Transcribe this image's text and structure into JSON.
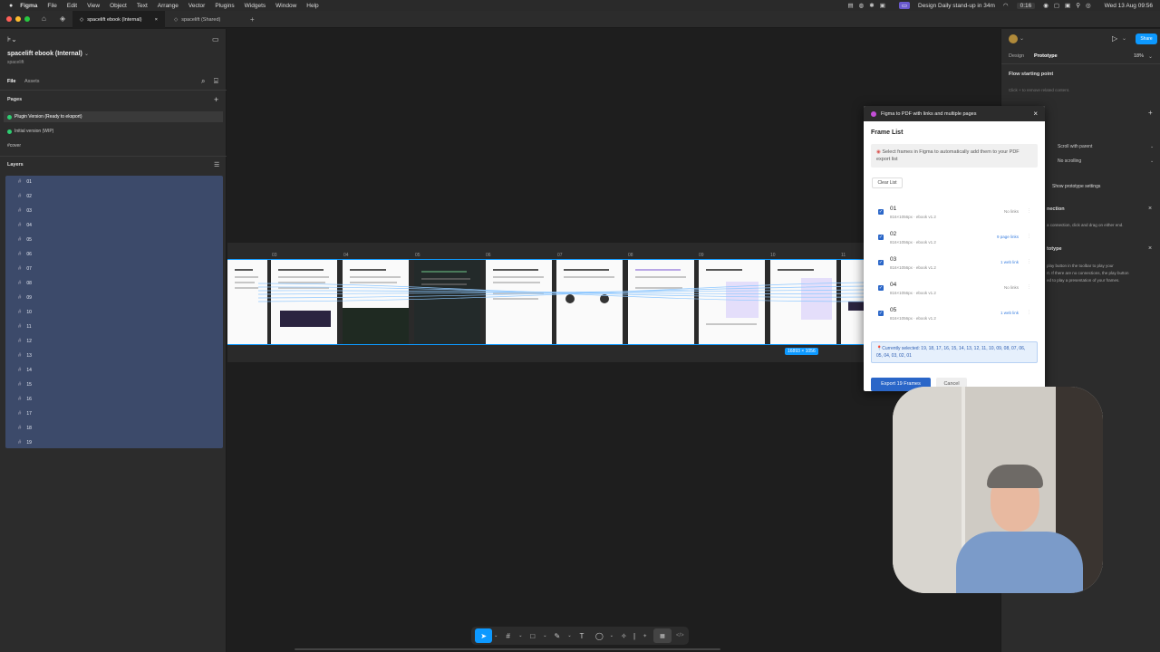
{
  "menubar": {
    "app": "Figma",
    "items": [
      "File",
      "Edit",
      "View",
      "Object",
      "Text",
      "Arrange",
      "Vector",
      "Plugins",
      "Widgets",
      "Window",
      "Help"
    ],
    "meeting": "Design Daily stand-up in 34m",
    "timer": "0:16",
    "clock": "Wed 13 Aug 09:56"
  },
  "tabs": [
    {
      "label": "spacelift ebook (Internal)",
      "active": true
    },
    {
      "label": "spacelift (Shared)",
      "active": false
    }
  ],
  "left": {
    "file_title": "spacelift ebook (Internal)",
    "team": "spacelift",
    "tab_file": "File",
    "tab_assets": "Assets",
    "pages_label": "Pages",
    "pages": [
      "Plugin Version (Ready to eksport)",
      "Initial version (WIP)",
      "#cover"
    ],
    "layers_label": "Layers",
    "layers": [
      "01",
      "02",
      "03",
      "04",
      "05",
      "06",
      "07",
      "08",
      "09",
      "10",
      "11",
      "12",
      "13",
      "14",
      "15",
      "16",
      "17",
      "18",
      "19"
    ]
  },
  "right": {
    "tab_design": "Design",
    "tab_prototype": "Prototype",
    "zoom": "18%",
    "share": "Share",
    "flow_title": "Flow starting point",
    "flow_hint": "Click + to remove related content.",
    "scroll": "Scroll with parent",
    "scrolling": "No scrolling",
    "show_settings": "Show prototype settings",
    "connection_title": "nection",
    "connection_text": "a connection, click and drag on either end.",
    "prototype_title": "totype",
    "prototype_text": "play button in the toolbar to play your\nrt. If there are no connections, the play button\ned to play a presentation of your frames."
  },
  "canvas": {
    "frame_numbers": [
      "03",
      "04",
      "05",
      "06",
      "07",
      "08",
      "09",
      "10",
      "11"
    ],
    "selection_size": "16893 × 1056"
  },
  "dialog": {
    "title": "Figma to PDF with links and multiple pages",
    "heading": "Frame List",
    "info": "Select frames in Figma to automatically add them to your PDF export list",
    "clear": "Clear List",
    "frames": [
      {
        "name": "01",
        "meta": "816×1056px · ebook v1.2",
        "links": "No links",
        "blue": false
      },
      {
        "name": "02",
        "meta": "816×1056px · ebook v1.2",
        "links": "9 page links",
        "blue": true
      },
      {
        "name": "03",
        "meta": "816×1056px · ebook v1.2",
        "links": "1 web link",
        "blue": true
      },
      {
        "name": "04",
        "meta": "816×1056px · ebook v1.2",
        "links": "No links",
        "blue": false
      },
      {
        "name": "05",
        "meta": "816×1056px · ebook v1.2",
        "links": "1 web link",
        "blue": true
      }
    ],
    "selected": "Currently selected: 19, 18, 17, 16, 15, 14, 13, 12, 11, 10, 09, 08, 07, 06, 05, 04, 03, 02, 01",
    "export": "Export 19 Frames",
    "cancel": "Cancel"
  },
  "colors": {
    "accent": "#0d99ff",
    "plugin_blue": "#2a66c8",
    "layer_selected": "#3c4a6a"
  }
}
